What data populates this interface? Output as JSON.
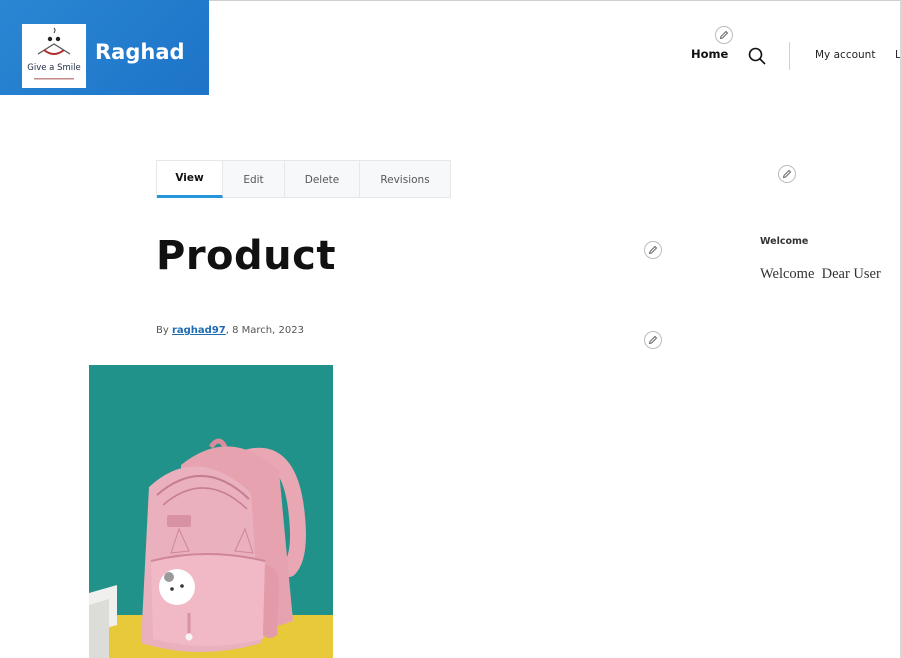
{
  "site": {
    "name": "Raghad",
    "logo_text": "Give a Smile"
  },
  "nav": {
    "home": "Home",
    "account": "My account",
    "cut_item": "L",
    "search_icon": "search-icon"
  },
  "tabs": [
    {
      "label": "View",
      "active": true
    },
    {
      "label": "Edit",
      "active": false
    },
    {
      "label": "Delete",
      "active": false
    },
    {
      "label": "Revisions",
      "active": false
    }
  ],
  "node": {
    "title": "Product",
    "by": "By ",
    "author": "raghad97",
    "date": ", 8 March, 2023"
  },
  "sidebar": {
    "block_title": "Welcome",
    "block_body": "Welcome  Dear User"
  },
  "colors": {
    "brand": "#1e74c8",
    "tab_active": "#2494db",
    "link": "#1d6bb3"
  }
}
